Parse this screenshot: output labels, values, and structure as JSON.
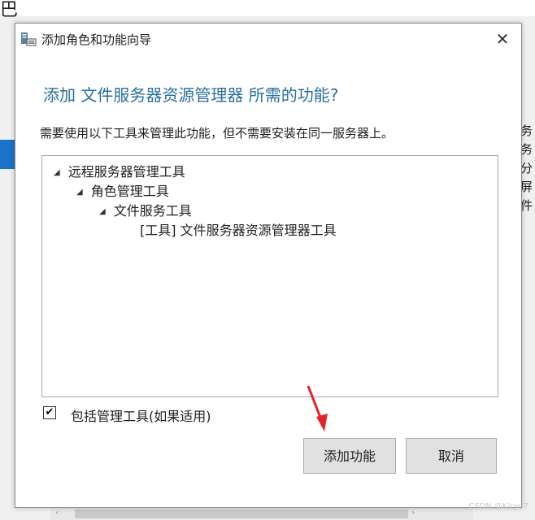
{
  "background": {
    "top_glyph": "巴",
    "right_text": [
      "务",
      "务",
      "分",
      "屏",
      "件"
    ],
    "watermark": "CSDN @Kiryu7"
  },
  "dialog": {
    "title": "添加角色和功能向导",
    "close_symbol": "✕",
    "heading": "添加 文件服务器资源管理器 所需的功能?",
    "description": "需要使用以下工具来管理此功能，但不需要安装在同一服务器上。",
    "tree": [
      {
        "label": "远程服务器管理工具",
        "expander": "◢"
      },
      {
        "label": "角色管理工具",
        "expander": "◢"
      },
      {
        "label": "文件服务工具",
        "expander": "◢"
      },
      {
        "label": "[工具] 文件服务器资源管理器工具",
        "expander": ""
      }
    ],
    "include_checkbox": {
      "checked": true,
      "mark": "✔",
      "label": "包括管理工具(如果适用)"
    },
    "buttons": {
      "add": "添加功能",
      "cancel": "取消"
    }
  },
  "colors": {
    "heading": "#2a6f9e",
    "accent": "#1a73c8",
    "annotation_arrow": "#e0262b"
  }
}
